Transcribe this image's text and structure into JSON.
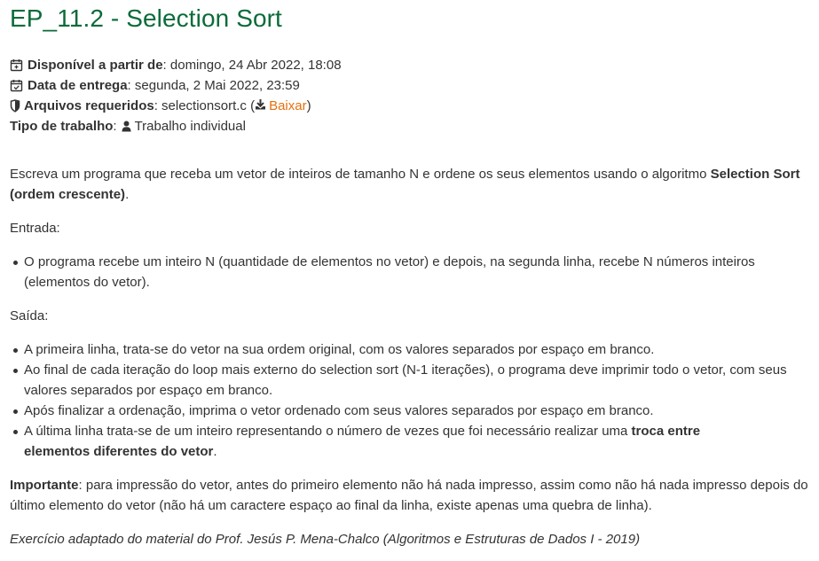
{
  "title": "EP_11.2 - Selection Sort",
  "meta": {
    "available": {
      "label": "Disponível a partir de",
      "value": ": domingo, 24 Abr 2022, 18:08",
      "icon": "calendar-plus-icon"
    },
    "due": {
      "label": "Data de entrega",
      "value": ": segunda, 2 Mai 2022, 23:59",
      "icon": "calendar-check-icon"
    },
    "files": {
      "label": "Arquivos requeridos",
      "value": ": selectionsort.c (",
      "download_label": "Baixar",
      "close": ")",
      "icon": "shield-icon",
      "download_icon": "download-icon"
    },
    "work_type": {
      "label": "Tipo de trabalho",
      "sep": ":",
      "value": "Trabalho individual",
      "icon": "user-icon"
    }
  },
  "description": {
    "intro_pre": "Escreva um programa que receba um vetor de inteiros de tamanho N e ordene os seus elementos usando o algoritmo ",
    "intro_bold": "Selection Sort (ordem crescente)",
    "intro_post": ".",
    "input_heading": "Entrada:",
    "input_items": [
      "O programa recebe um inteiro N (quantidade de elementos no vetor) e depois, na segunda linha, recebe N números inteiros (elementos do vetor)."
    ],
    "output_heading": "Saída:",
    "output_items": [
      "A primeira linha, trata-se do vetor na sua ordem original, com os valores separados por espaço em branco.",
      "Ao final de cada iteração do loop mais externo do selection sort (N-1 iterações), o programa deve imprimir todo o vetor, com seus valores separados por espaço em branco.",
      "Após finalizar a ordenação, imprima o vetor ordenado com seus valores separados por espaço em branco."
    ],
    "output_last_pre": "A última linha trata-se de um inteiro representando o número de vezes que foi necessário realizar uma ",
    "output_last_bold_1": "troca entre",
    "output_last_bold_2": "elementos diferentes do vetor",
    "output_last_post": ".",
    "important_label": "Importante",
    "important_text": ": para impressão do vetor, antes do primeiro elemento não há nada impresso, assim como não há nada impresso depois do último elemento do vetor (não há um caractere espaço ao final da linha, existe apenas uma quebra de linha).",
    "credit": "Exercício adaptado do material do Prof. Jesús P. Mena-Chalco (Algoritmos e Estruturas de Dados I - 2019)"
  },
  "colors": {
    "title": "#0b6b3a",
    "text": "#333333",
    "link": "#e6700c"
  }
}
